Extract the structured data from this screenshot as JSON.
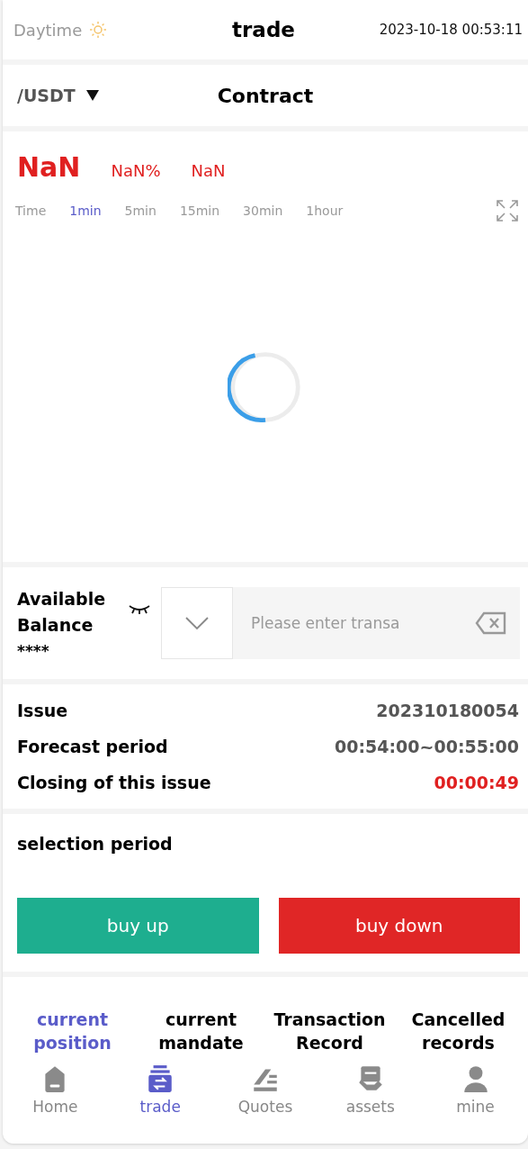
{
  "header": {
    "mode_label": "Daytime",
    "title": "trade",
    "datetime": "2023-10-18 00:53:11"
  },
  "pair": {
    "symbol": "/USDT",
    "title": "Contract"
  },
  "price": {
    "value": "NaN",
    "change_pct": "NaN%",
    "change": "NaN"
  },
  "intervals": [
    {
      "label": "Time",
      "selected": false
    },
    {
      "label": "1min",
      "selected": true
    },
    {
      "label": "5min",
      "selected": false
    },
    {
      "label": "15min",
      "selected": false
    },
    {
      "label": "30min",
      "selected": false
    },
    {
      "label": "1hour",
      "selected": false
    }
  ],
  "balance": {
    "label": "Available Balance",
    "value": "****"
  },
  "amount_field": {
    "placeholder": "Please enter transa"
  },
  "issue_rows": [
    {
      "label": "Issue",
      "value": "202310180054",
      "kind": "normal"
    },
    {
      "label": "Forecast period",
      "value": "00:54:00~00:55:00",
      "kind": "normal"
    },
    {
      "label": "Closing of this issue",
      "value": "00:00:49",
      "kind": "countdown"
    }
  ],
  "selection": {
    "title": "selection period"
  },
  "trade_buttons": [
    {
      "label": "buy up",
      "kind": "up"
    },
    {
      "label": "buy down",
      "kind": "down"
    }
  ],
  "record_tabs": [
    {
      "label": "current position",
      "selected": true
    },
    {
      "label": "current mandate",
      "selected": false
    },
    {
      "label": "Transaction Record",
      "selected": false
    },
    {
      "label": "Cancelled records",
      "selected": false
    }
  ],
  "nav": [
    {
      "label": "Home",
      "kind": "home",
      "selected": false
    },
    {
      "label": "trade",
      "kind": "trade",
      "selected": true
    },
    {
      "label": "Quotes",
      "kind": "quotes",
      "selected": false
    },
    {
      "label": "assets",
      "kind": "assets",
      "selected": false
    },
    {
      "label": "mine",
      "kind": "mine",
      "selected": false
    }
  ]
}
